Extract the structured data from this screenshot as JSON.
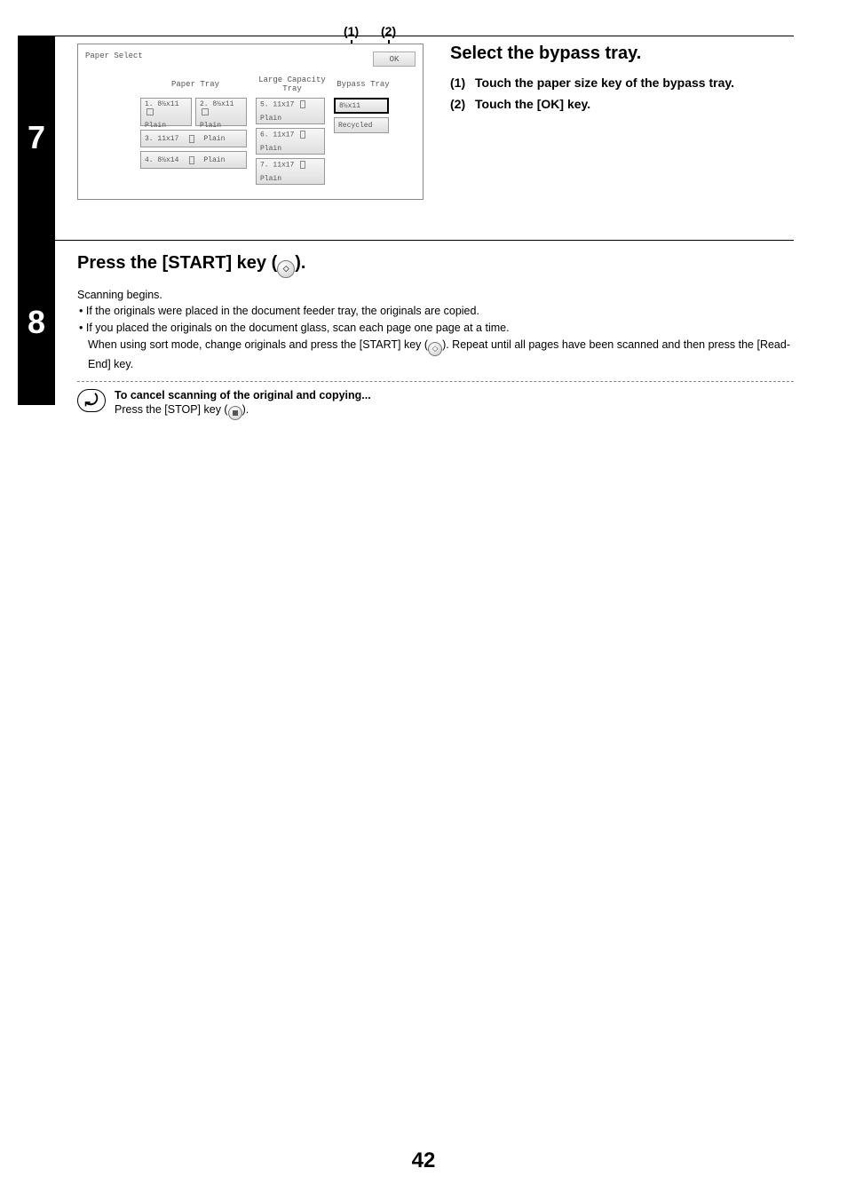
{
  "step7": {
    "number": "7",
    "callouts": {
      "c1": "(1)",
      "c2": "(2)"
    },
    "panel": {
      "title": "Paper Select",
      "ok": "OK",
      "paperTrayLabel": "Paper Tray",
      "largeCapLabel": "Large Capacity\nTray",
      "bypassLabel": "Bypass Tray",
      "trays": {
        "t1": {
          "size": "1. 8½x11",
          "type": "Plain"
        },
        "t2": {
          "size": "2. 8½x11",
          "type": "Plain"
        },
        "t3": {
          "size": "3. 11x17",
          "type": "Plain"
        },
        "t4": {
          "size": "4. 8½x14",
          "type": "Plain"
        },
        "t5": {
          "size": "5. 11x17",
          "type": "Plain"
        },
        "t6": {
          "size": "6. 11x17",
          "type": "Plain"
        },
        "t7": {
          "size": "7. 11x17",
          "type": "Plain"
        }
      },
      "bypass": {
        "size": "8½x11",
        "type": "Recycled"
      }
    },
    "heading": "Select the bypass tray.",
    "items": {
      "i1": "Touch the paper size key of the bypass tray.",
      "i2": "Touch the [OK] key."
    }
  },
  "step8": {
    "number": "8",
    "heading_pre": "Press the [START] key (",
    "heading_post": ").",
    "scanning": "Scanning begins.",
    "b1": "If the originals were placed in the document feeder tray, the originals are copied.",
    "b2": "If you placed the originals on the document glass, scan each page one page at a time.",
    "b3a": "When using sort mode, change originals and press the [START] key (",
    "b3b": "). Repeat until all pages have been scanned and then press the [Read-End] key.",
    "cancel_title": "To cancel scanning of the original and copying...",
    "cancel_body_a": "Press the [STOP] key (",
    "cancel_body_b": ")."
  },
  "pageNumber": "42"
}
